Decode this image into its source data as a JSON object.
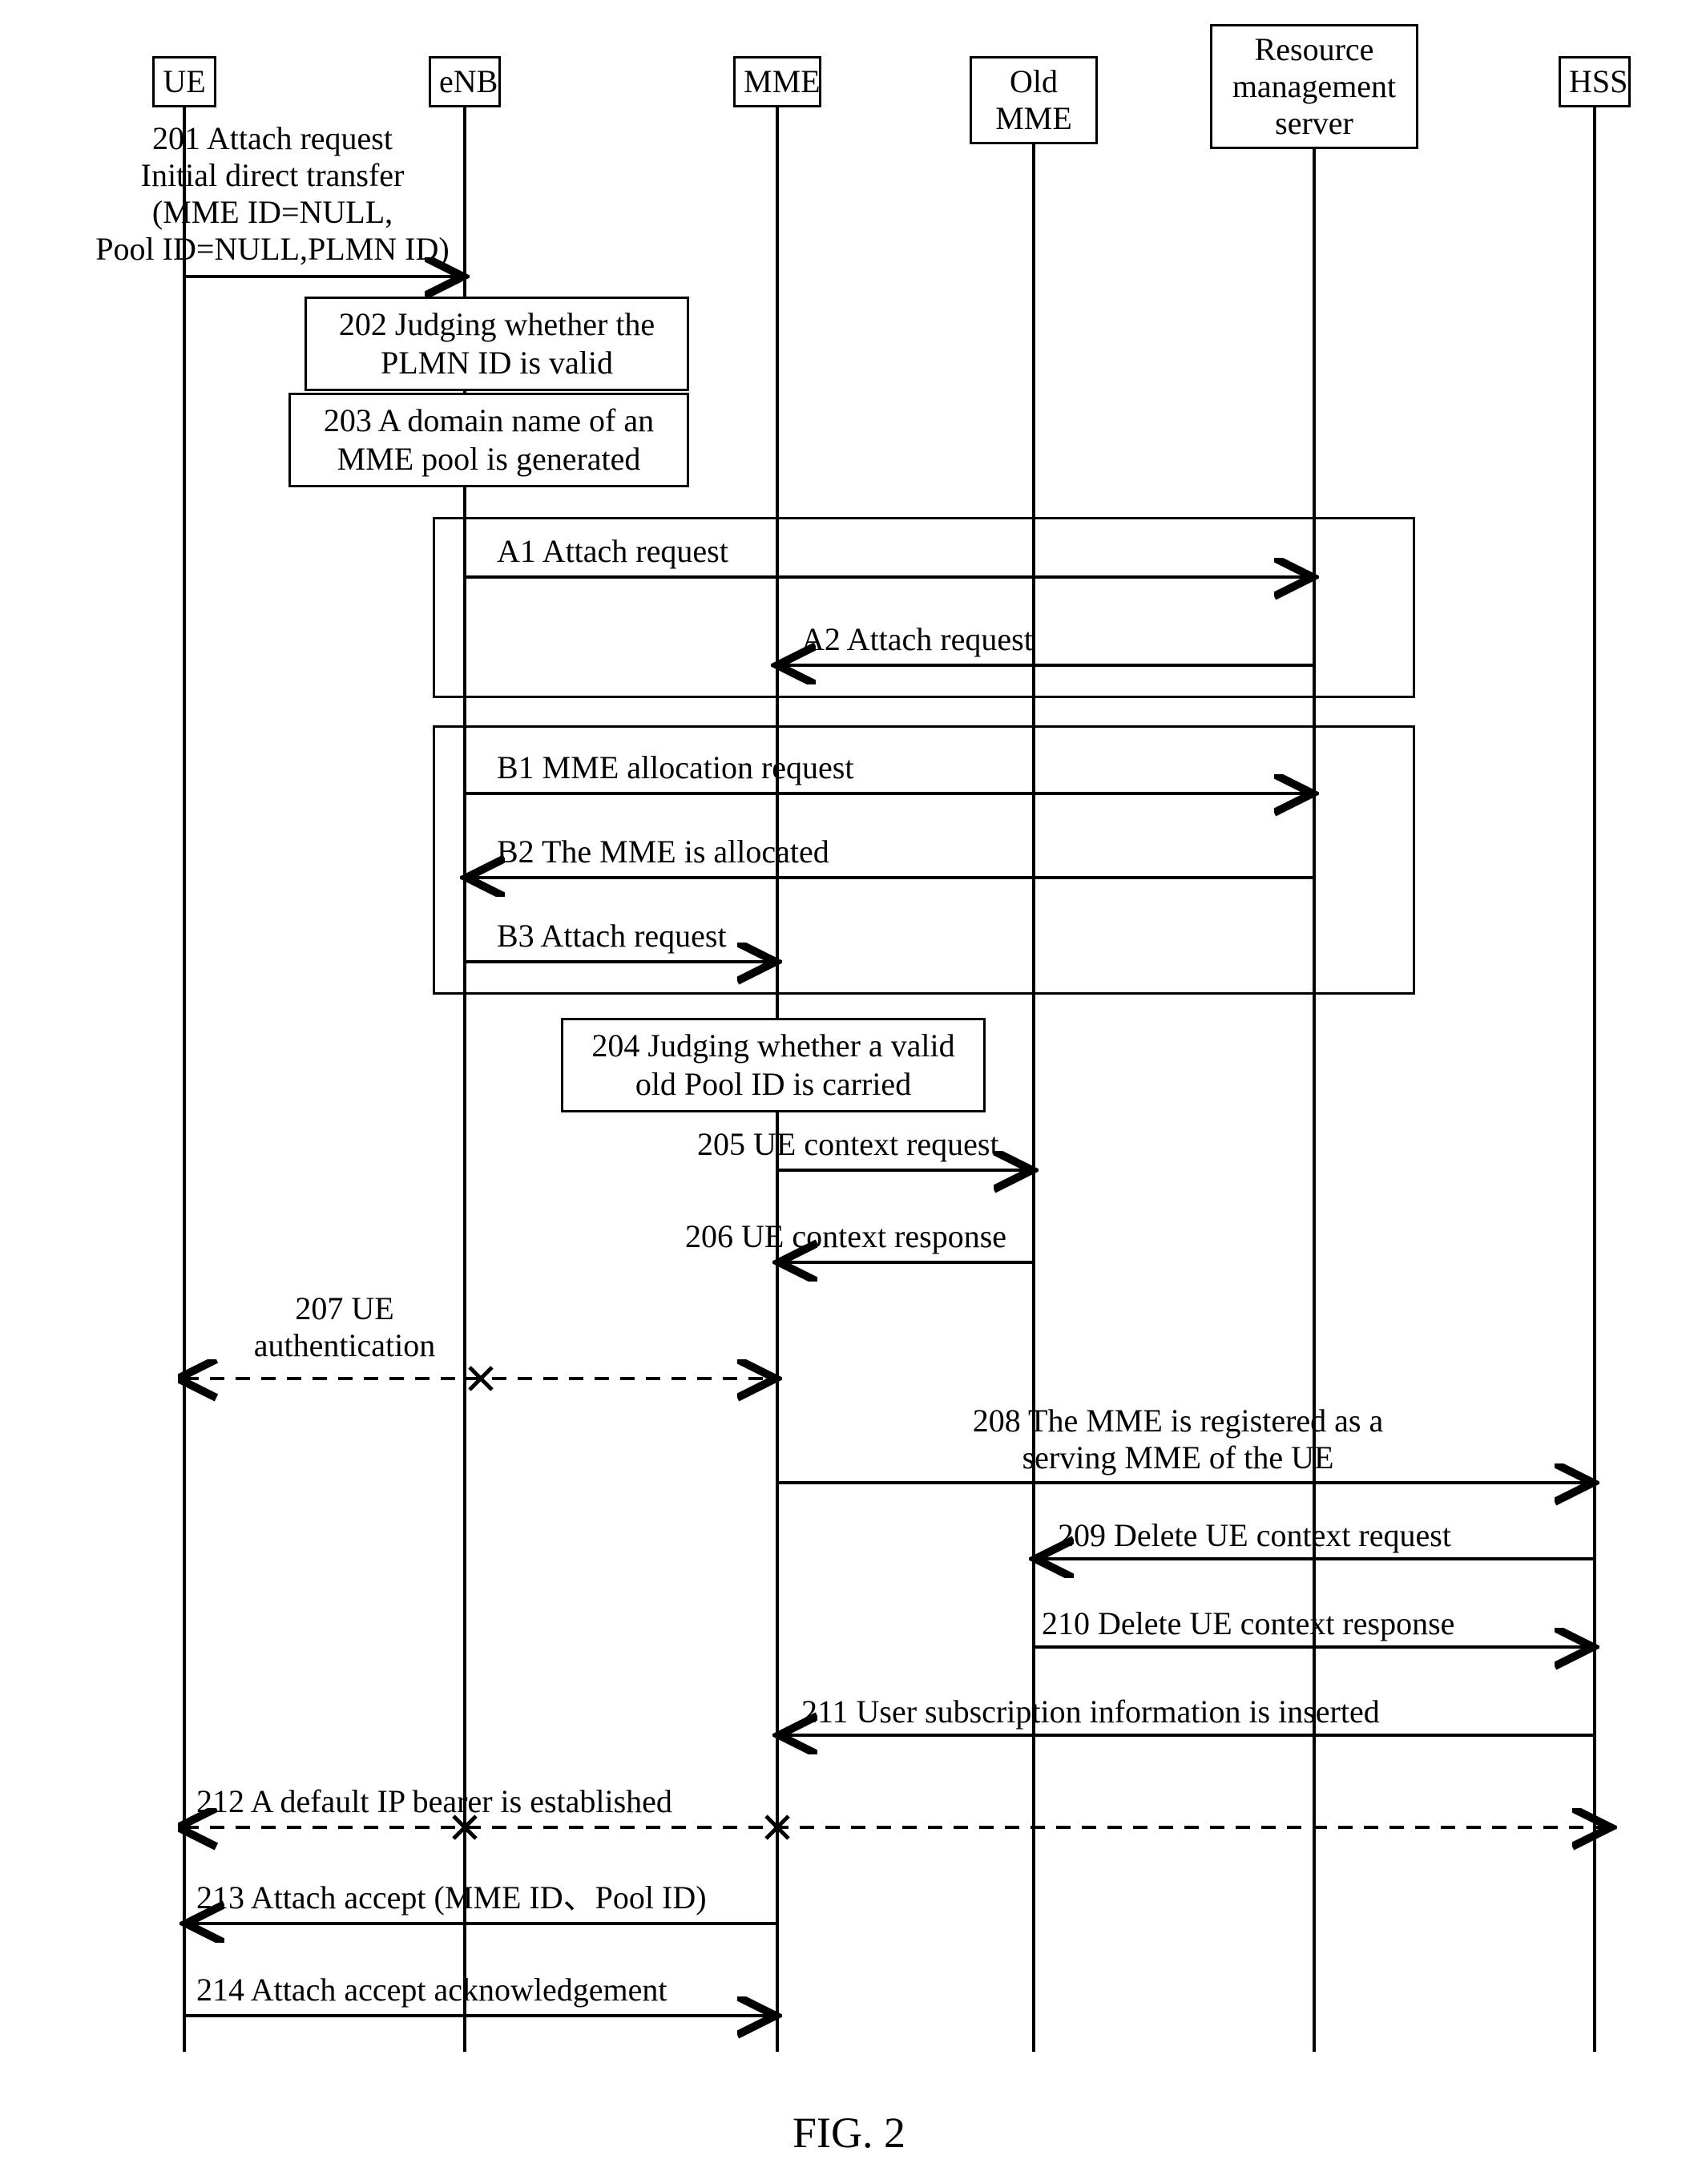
{
  "actors": {
    "ue": {
      "label": "UE"
    },
    "enb": {
      "label": "eNB"
    },
    "mme": {
      "label": "MME"
    },
    "old": {
      "label": "Old MME"
    },
    "rms": {
      "label": "Resource\nmanagement\nserver"
    },
    "hss": {
      "label": "HSS"
    }
  },
  "boxes": {
    "step202": "202 Judging whether the\nPLMN ID is valid",
    "step203": "203 A domain name of an\nMME pool is generated",
    "step204": "204 Judging whether a\nvalid old Pool ID is carried"
  },
  "labels": {
    "m201": "201 Attach request\nInitial direct transfer\n(MME ID=NULL,\nPool ID=NULL,PLMN ID)",
    "a1": "A1 Attach request",
    "a2": "A2 Attach request",
    "b1": "B1 MME allocation request",
    "b2": "B2 The MME is allocated",
    "b3": "B3 Attach request",
    "m205": "205 UE context request",
    "m206": "206 UE context response",
    "m207": "207 UE\nauthentication",
    "m208": "208 The MME is registered as a\nserving MME of the UE",
    "m209": "209 Delete UE context request",
    "m210": "210 Delete UE context response",
    "m211": "211 User subscription information is inserted",
    "m212": "212 A default IP bearer is established",
    "m213": "213 Attach accept (MME ID、Pool ID)",
    "m214": "214 Attach accept acknowledgement"
  },
  "figure": "FIG. 2",
  "chart_data": {
    "type": "sequence-diagram",
    "title": "FIG. 2",
    "participants": [
      "UE",
      "eNB",
      "MME",
      "Old MME",
      "Resource management server",
      "HSS"
    ],
    "messages": [
      {
        "id": "201",
        "from": "UE",
        "to": "eNB",
        "text": "201 Attach request Initial direct transfer (MME ID=NULL, Pool ID=NULL, PLMN ID)"
      },
      {
        "id": "202",
        "at": "eNB",
        "type": "self",
        "text": "202 Judging whether the PLMN ID is valid"
      },
      {
        "id": "203",
        "at": "eNB",
        "type": "self",
        "text": "203 A domain name of an MME pool is generated"
      },
      {
        "group": "A",
        "messages": [
          {
            "id": "A1",
            "from": "eNB",
            "to": "Resource management server",
            "text": "A1 Attach request"
          },
          {
            "id": "A2",
            "from": "Resource management server",
            "to": "MME",
            "text": "A2 Attach request"
          }
        ]
      },
      {
        "group": "B",
        "messages": [
          {
            "id": "B1",
            "from": "eNB",
            "to": "Resource management server",
            "text": "B1 MME allocation request"
          },
          {
            "id": "B2",
            "from": "Resource management server",
            "to": "eNB",
            "text": "B2 The MME is allocated"
          },
          {
            "id": "B3",
            "from": "eNB",
            "to": "MME",
            "text": "B3 Attach request"
          }
        ]
      },
      {
        "id": "204",
        "at": "MME",
        "type": "self",
        "text": "204 Judging whether a valid old Pool ID is carried"
      },
      {
        "id": "205",
        "from": "MME",
        "to": "Old MME",
        "text": "205 UE context request"
      },
      {
        "id": "206",
        "from": "Old MME",
        "to": "MME",
        "text": "206 UE context response"
      },
      {
        "id": "207",
        "from": "UE",
        "to": "MME",
        "style": "dashed-both",
        "text": "207 UE authentication"
      },
      {
        "id": "208",
        "from": "MME",
        "to": "HSS",
        "text": "208 The MME is registered as a serving MME of the UE"
      },
      {
        "id": "209",
        "from": "HSS",
        "to": "Old MME",
        "text": "209 Delete UE context request"
      },
      {
        "id": "210",
        "from": "Old MME",
        "to": "HSS",
        "text": "210 Delete UE context response"
      },
      {
        "id": "211",
        "from": "HSS",
        "to": "MME",
        "text": "211 User subscription information is inserted"
      },
      {
        "id": "212",
        "from": "UE",
        "to": "HSS",
        "style": "dashed-both-cross",
        "text": "212 A default IP bearer is established"
      },
      {
        "id": "213",
        "from": "MME",
        "to": "UE",
        "text": "213 Attach accept (MME ID, Pool ID)"
      },
      {
        "id": "214",
        "from": "UE",
        "to": "MME",
        "text": "214 Attach accept acknowledgement"
      }
    ]
  }
}
